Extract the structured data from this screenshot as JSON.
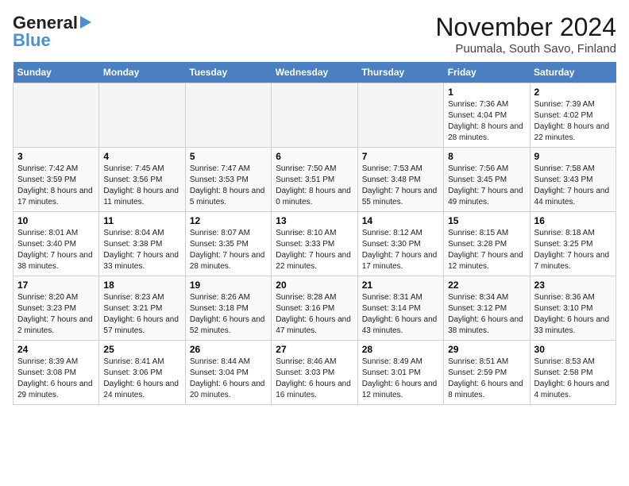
{
  "header": {
    "logo_line1": "General",
    "logo_line2": "Blue",
    "month": "November 2024",
    "location": "Puumala, South Savo, Finland"
  },
  "weekdays": [
    "Sunday",
    "Monday",
    "Tuesday",
    "Wednesday",
    "Thursday",
    "Friday",
    "Saturday"
  ],
  "weeks": [
    [
      {
        "day": "",
        "info": ""
      },
      {
        "day": "",
        "info": ""
      },
      {
        "day": "",
        "info": ""
      },
      {
        "day": "",
        "info": ""
      },
      {
        "day": "",
        "info": ""
      },
      {
        "day": "1",
        "info": "Sunrise: 7:36 AM\nSunset: 4:04 PM\nDaylight: 8 hours\nand 28 minutes."
      },
      {
        "day": "2",
        "info": "Sunrise: 7:39 AM\nSunset: 4:02 PM\nDaylight: 8 hours\nand 22 minutes."
      }
    ],
    [
      {
        "day": "3",
        "info": "Sunrise: 7:42 AM\nSunset: 3:59 PM\nDaylight: 8 hours\nand 17 minutes."
      },
      {
        "day": "4",
        "info": "Sunrise: 7:45 AM\nSunset: 3:56 PM\nDaylight: 8 hours\nand 11 minutes."
      },
      {
        "day": "5",
        "info": "Sunrise: 7:47 AM\nSunset: 3:53 PM\nDaylight: 8 hours\nand 5 minutes."
      },
      {
        "day": "6",
        "info": "Sunrise: 7:50 AM\nSunset: 3:51 PM\nDaylight: 8 hours\nand 0 minutes."
      },
      {
        "day": "7",
        "info": "Sunrise: 7:53 AM\nSunset: 3:48 PM\nDaylight: 7 hours\nand 55 minutes."
      },
      {
        "day": "8",
        "info": "Sunrise: 7:56 AM\nSunset: 3:45 PM\nDaylight: 7 hours\nand 49 minutes."
      },
      {
        "day": "9",
        "info": "Sunrise: 7:58 AM\nSunset: 3:43 PM\nDaylight: 7 hours\nand 44 minutes."
      }
    ],
    [
      {
        "day": "10",
        "info": "Sunrise: 8:01 AM\nSunset: 3:40 PM\nDaylight: 7 hours\nand 38 minutes."
      },
      {
        "day": "11",
        "info": "Sunrise: 8:04 AM\nSunset: 3:38 PM\nDaylight: 7 hours\nand 33 minutes."
      },
      {
        "day": "12",
        "info": "Sunrise: 8:07 AM\nSunset: 3:35 PM\nDaylight: 7 hours\nand 28 minutes."
      },
      {
        "day": "13",
        "info": "Sunrise: 8:10 AM\nSunset: 3:33 PM\nDaylight: 7 hours\nand 22 minutes."
      },
      {
        "day": "14",
        "info": "Sunrise: 8:12 AM\nSunset: 3:30 PM\nDaylight: 7 hours\nand 17 minutes."
      },
      {
        "day": "15",
        "info": "Sunrise: 8:15 AM\nSunset: 3:28 PM\nDaylight: 7 hours\nand 12 minutes."
      },
      {
        "day": "16",
        "info": "Sunrise: 8:18 AM\nSunset: 3:25 PM\nDaylight: 7 hours\nand 7 minutes."
      }
    ],
    [
      {
        "day": "17",
        "info": "Sunrise: 8:20 AM\nSunset: 3:23 PM\nDaylight: 7 hours\nand 2 minutes."
      },
      {
        "day": "18",
        "info": "Sunrise: 8:23 AM\nSunset: 3:21 PM\nDaylight: 6 hours\nand 57 minutes."
      },
      {
        "day": "19",
        "info": "Sunrise: 8:26 AM\nSunset: 3:18 PM\nDaylight: 6 hours\nand 52 minutes."
      },
      {
        "day": "20",
        "info": "Sunrise: 8:28 AM\nSunset: 3:16 PM\nDaylight: 6 hours\nand 47 minutes."
      },
      {
        "day": "21",
        "info": "Sunrise: 8:31 AM\nSunset: 3:14 PM\nDaylight: 6 hours\nand 43 minutes."
      },
      {
        "day": "22",
        "info": "Sunrise: 8:34 AM\nSunset: 3:12 PM\nDaylight: 6 hours\nand 38 minutes."
      },
      {
        "day": "23",
        "info": "Sunrise: 8:36 AM\nSunset: 3:10 PM\nDaylight: 6 hours\nand 33 minutes."
      }
    ],
    [
      {
        "day": "24",
        "info": "Sunrise: 8:39 AM\nSunset: 3:08 PM\nDaylight: 6 hours\nand 29 minutes."
      },
      {
        "day": "25",
        "info": "Sunrise: 8:41 AM\nSunset: 3:06 PM\nDaylight: 6 hours\nand 24 minutes."
      },
      {
        "day": "26",
        "info": "Sunrise: 8:44 AM\nSunset: 3:04 PM\nDaylight: 6 hours\nand 20 minutes."
      },
      {
        "day": "27",
        "info": "Sunrise: 8:46 AM\nSunset: 3:03 PM\nDaylight: 6 hours\nand 16 minutes."
      },
      {
        "day": "28",
        "info": "Sunrise: 8:49 AM\nSunset: 3:01 PM\nDaylight: 6 hours\nand 12 minutes."
      },
      {
        "day": "29",
        "info": "Sunrise: 8:51 AM\nSunset: 2:59 PM\nDaylight: 6 hours\nand 8 minutes."
      },
      {
        "day": "30",
        "info": "Sunrise: 8:53 AM\nSunset: 2:58 PM\nDaylight: 6 hours\nand 4 minutes."
      }
    ]
  ]
}
